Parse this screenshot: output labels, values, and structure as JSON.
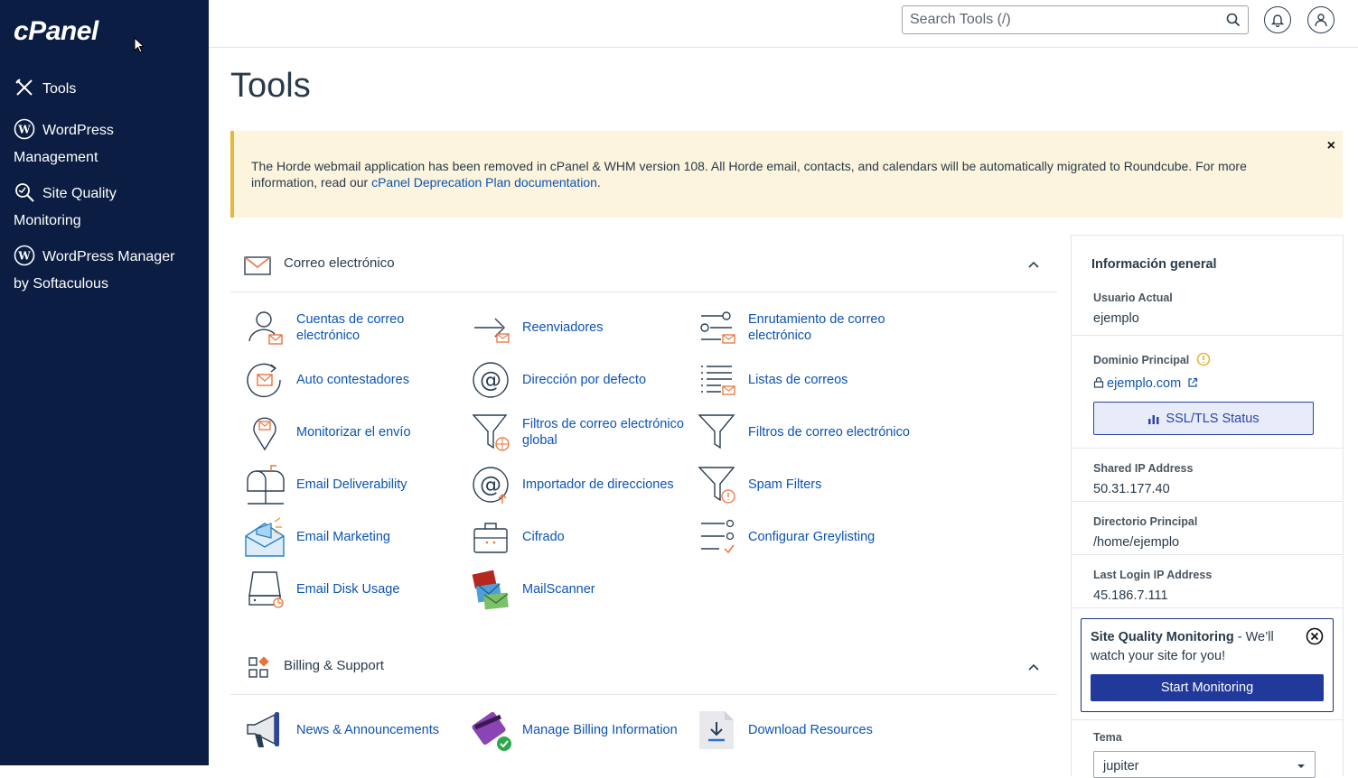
{
  "sidebar": {
    "logo": "cPanel",
    "items": [
      {
        "label": "Tools"
      },
      {
        "line1": "WordPress",
        "line2": "Management"
      },
      {
        "line1": "Site Quality",
        "line2": "Monitoring"
      },
      {
        "line1": "WordPress Manager",
        "line2": "by Softaculous"
      }
    ]
  },
  "topbar": {
    "search_placeholder": "Search Tools (/)"
  },
  "page": {
    "title": "Tools"
  },
  "notice": {
    "text": "The Horde webmail application has been removed in cPanel & WHM version 108. All Horde email, contacts, and calendars will be automatically migrated to Roundcube. For more information, read our ",
    "link": "cPanel Deprecation Plan documentation",
    "end": ".",
    "close": "×"
  },
  "sections": {
    "email": {
      "title": "Correo electrónico",
      "tools": [
        [
          "Cuentas de correo electrónico",
          "Reenviadores",
          "Enrutamiento de correo electrónico"
        ],
        [
          "Auto contestadores",
          "Dirección por defecto",
          "Listas de correos"
        ],
        [
          "Monitorizar el envío",
          "Filtros de correo electrónico global",
          "Filtros de correo electrónico"
        ],
        [
          "Email Deliverability",
          "Importador de direcciones",
          "Spam Filters"
        ],
        [
          "Email Marketing",
          "Cifrado",
          "Configurar Greylisting"
        ],
        [
          "Email Disk Usage",
          "MailScanner"
        ]
      ]
    },
    "billing": {
      "title": "Billing & Support",
      "tools": [
        "News & Announcements",
        "Manage Billing Information",
        "Download Resources"
      ]
    }
  },
  "general_info": {
    "title": "Información general",
    "current_user_label": "Usuario Actual",
    "current_user": "ejemplo",
    "primary_domain_label": "Dominio Principal",
    "primary_domain": "ejemplo.com",
    "ssl_button": "SSL/TLS Status",
    "shared_ip_label": "Shared IP Address",
    "shared_ip": "50.31.177.40",
    "home_dir_label": "Directorio Principal",
    "home_dir": "/home/ejemplo",
    "last_login_label": "Last Login IP Address",
    "last_login": "45.186.7.111",
    "sqm_title": "Site Quality Monitoring",
    "sqm_text": " - We’ll watch your site for you!",
    "sqm_button": "Start Monitoring",
    "theme_label": "Tema",
    "theme_value": "jupiter"
  },
  "colors": {
    "sidebar_bg": "#0b1d42",
    "link": "#0b53b6",
    "accent_orange": "#e8743b",
    "primary_button": "#20399a"
  }
}
